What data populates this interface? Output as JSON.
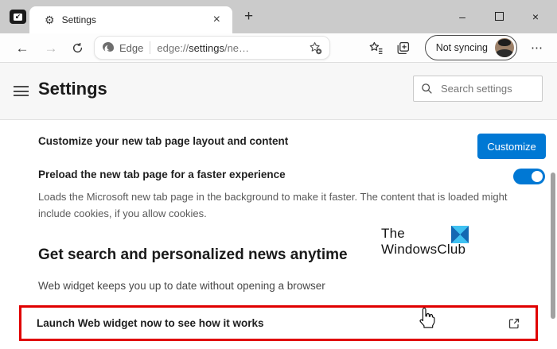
{
  "icons": {
    "tab_actions": "↙",
    "gear": "⚙",
    "close_tab": "×",
    "new_tab": "+",
    "minimize": "–",
    "close_window": "×",
    "back": "←",
    "forward": "→",
    "more": "⋯",
    "search": "magnifier",
    "favorites": "star-with-lines",
    "collections": "stacked-panels-plus",
    "add_favorite": "star-plus",
    "open_external": "box-with-arrow",
    "hamburger": "three-bars"
  },
  "tab": {
    "title": "Settings"
  },
  "toolbar": {
    "site_button_label": "Edge",
    "url": {
      "scheme": "edge://",
      "host": "settings",
      "path": "/ne…"
    },
    "profile_label": "Not syncing"
  },
  "settings": {
    "title": "Settings",
    "search_placeholder": "Search settings"
  },
  "content": {
    "customize_row": {
      "label": "Customize your new tab page layout and content",
      "button_label": "Customize"
    },
    "preload_row": {
      "label": "Preload the new tab page for a faster experience",
      "description": "Loads the Microsoft new tab page in the background to make it faster. The content that is loaded might include cookies, if you allow cookies.",
      "toggle_state": "on"
    },
    "watermark": {
      "line1": "The",
      "line2": "WindowsClub"
    },
    "news_section": {
      "heading": "Get search and personalized news anytime",
      "subtext": "Web widget keeps you up to date without opening a browser"
    },
    "launch_row": {
      "label": "Launch Web widget now to see how it works"
    }
  },
  "colors": {
    "accent_blue": "#0078D4",
    "annotation_red": "#E00000",
    "titlebar_gray": "#CBCBCB"
  }
}
